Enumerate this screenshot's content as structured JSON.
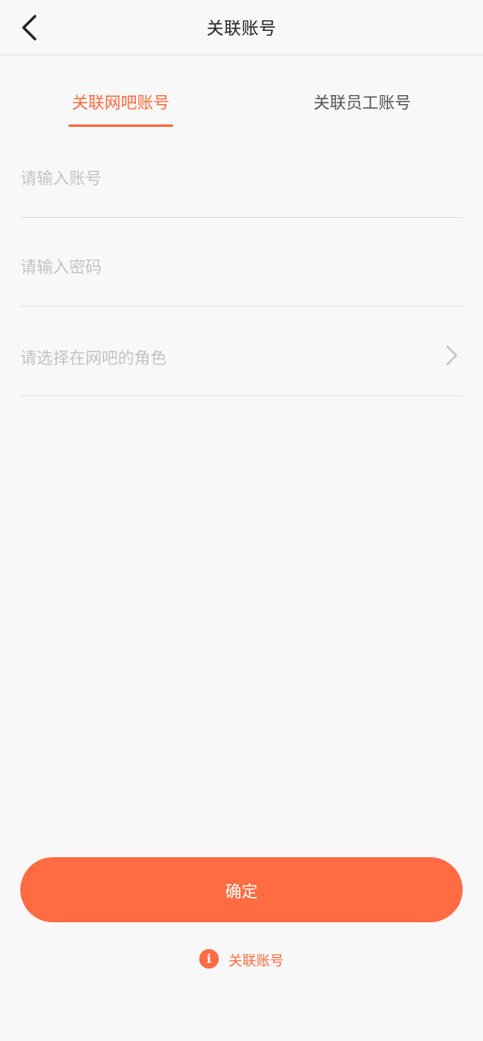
{
  "navbar": {
    "title": "关联账号",
    "back_icon": "chevron-left-icon"
  },
  "tabs": [
    {
      "label": "关联网吧账号",
      "active": true
    },
    {
      "label": "关联员工账号",
      "active": false
    }
  ],
  "form": {
    "account_placeholder": "请输入账号",
    "account_value": "",
    "password_placeholder": "请输入密码",
    "password_value": "",
    "role_placeholder": "请选择在网吧的角色",
    "role_icon": "chevron-right-icon"
  },
  "confirm_button": {
    "label": "确定"
  },
  "footer": {
    "icon": "info-icon",
    "icon_glyph": "i",
    "text": "关联账号"
  },
  "colors": {
    "accent": "#ff6b42",
    "background": "#f8f8f8",
    "placeholder": "#c3c3c3",
    "divider": "#e0e0e0"
  }
}
